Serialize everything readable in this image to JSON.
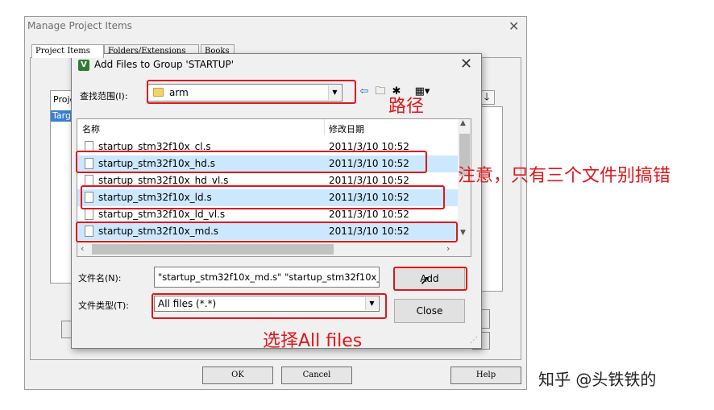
{
  "background_window": {
    "title": "Manage Project Items",
    "tabs": [
      "Project Items",
      "Folders/Extensions",
      "Books"
    ],
    "left_list_header": "Projec",
    "left_list_item": "Targe",
    "buttons": {
      "ok": "OK",
      "cancel": "Cancel",
      "help": "Help"
    }
  },
  "dialog": {
    "title": "Add Files to Group 'STARTUP'",
    "look_in_label": "查找范围(I):",
    "look_in_value": "arm",
    "columns": {
      "name": "名称",
      "date": "修改日期"
    },
    "files": [
      {
        "name": "startup_stm32f10x_cl.s",
        "date": "2011/3/10 10:52",
        "selected": false
      },
      {
        "name": "startup_stm32f10x_hd.s",
        "date": "2011/3/10 10:52",
        "selected": true
      },
      {
        "name": "startup_stm32f10x_hd_vl.s",
        "date": "2011/3/10 10:52",
        "selected": false
      },
      {
        "name": "startup_stm32f10x_ld.s",
        "date": "2011/3/10 10:52",
        "selected": true
      },
      {
        "name": "startup_stm32f10x_ld_vl.s",
        "date": "2011/3/10 10:52",
        "selected": false
      },
      {
        "name": "startup_stm32f10x_md.s",
        "date": "2011/3/10 10:52",
        "selected": true
      }
    ],
    "filename_label": "文件名(N):",
    "filename_value": "\"startup_stm32f10x_md.s\" \"startup_stm32f10x_h",
    "filetype_label": "文件类型(T):",
    "filetype_value": "All files (*.*)",
    "add_button": "Add",
    "close_button": "Close"
  },
  "annotations": {
    "path": "路径",
    "note": "注意，只有三个文件别搞错",
    "select_all": "选择All files",
    "color": "#e0161b"
  },
  "watermark": "知乎 @头铁铁的"
}
